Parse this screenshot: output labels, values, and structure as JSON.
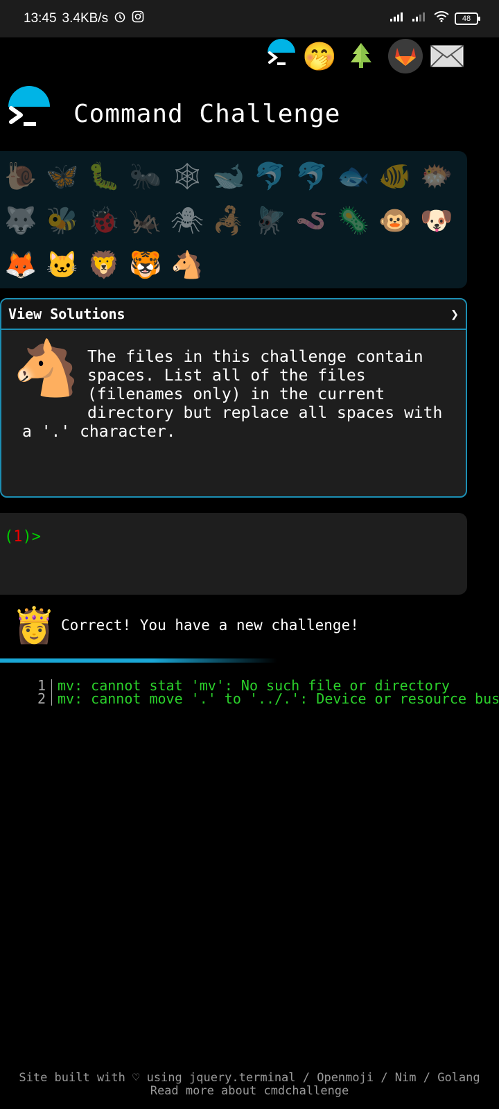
{
  "status_bar": {
    "time": "13:45",
    "speed": "3.4KB/s",
    "battery": "48"
  },
  "top_icons": [
    "terminal-icon",
    "face-with-hand-over-mouth-icon",
    "tree-icon",
    "gitlab-icon",
    "envelope-icon"
  ],
  "header": {
    "title": "Command Challenge"
  },
  "animals": [
    {
      "icon": "🐌",
      "name": "snail-icon",
      "dim": true
    },
    {
      "icon": "🦋",
      "name": "butterfly-icon",
      "dim": true
    },
    {
      "icon": "🐛",
      "name": "bug-icon",
      "dim": true
    },
    {
      "icon": "🐜",
      "name": "ant-icon",
      "dim": true
    },
    {
      "icon": "🕸",
      "name": "spider-web-icon",
      "dim": true
    },
    {
      "icon": "🐋",
      "name": "whale-icon",
      "dim": true
    },
    {
      "icon": "🐬",
      "name": "dolphin-icon",
      "dim": true
    },
    {
      "icon": "🐬",
      "name": "dolphin-grey-icon",
      "dim": true
    },
    {
      "icon": "🐟",
      "name": "fish-icon",
      "dim": true
    },
    {
      "icon": "🐠",
      "name": "tropical-fish-icon",
      "dim": true
    },
    {
      "icon": "🐡",
      "name": "blowfish-icon",
      "dim": true
    },
    {
      "icon": "🐺",
      "name": "wolf-icon",
      "dim": true
    },
    {
      "icon": "🐝",
      "name": "bee-icon",
      "dim": true
    },
    {
      "icon": "🐞",
      "name": "ladybug-icon",
      "dim": true
    },
    {
      "icon": "🦗",
      "name": "cricket-icon",
      "dim": true
    },
    {
      "icon": "🕷",
      "name": "spider-icon",
      "dim": true
    },
    {
      "icon": "🦂",
      "name": "scorpion-icon",
      "dim": true
    },
    {
      "icon": "🪰",
      "name": "fly-icon",
      "dim": true
    },
    {
      "icon": "🪱",
      "name": "worm-icon",
      "dim": true
    },
    {
      "icon": "🦠",
      "name": "microbe-icon",
      "dim": true
    },
    {
      "icon": "🐵",
      "name": "monkey-icon",
      "dim": false
    },
    {
      "icon": "🐶",
      "name": "dog-icon",
      "dim": false
    },
    {
      "icon": "🦊",
      "name": "fox-icon",
      "dim": false
    },
    {
      "icon": "🐱",
      "name": "cat-icon",
      "dim": false
    },
    {
      "icon": "🦁",
      "name": "lion-icon",
      "dim": false
    },
    {
      "icon": "🐯",
      "name": "tiger-icon",
      "dim": false
    },
    {
      "icon": "🐴",
      "name": "horse-icon",
      "dim": false
    }
  ],
  "solutions": {
    "header": "View Solutions",
    "chevron": "❯",
    "description": "The files in this challenge contain spaces. List all of the files (filenames only) in the current directory but replace all spaces with a '.' character."
  },
  "terminal": {
    "prompt_open": "(",
    "prompt_num": "1",
    "prompt_close": ")>"
  },
  "feedback": {
    "message": "Correct! You have a new challenge!"
  },
  "output": [
    {
      "num": "1",
      "text": "mv: cannot stat 'mv': No such file or directory"
    },
    {
      "num": "2",
      "text": "mv: cannot move '.' to '../.': Device or resource busy"
    }
  ],
  "footer": {
    "line1": "Site built with ♡ using jquery.terminal / Openmoji / Nim / Golang",
    "line2": "Read more about cmdchallenge"
  }
}
